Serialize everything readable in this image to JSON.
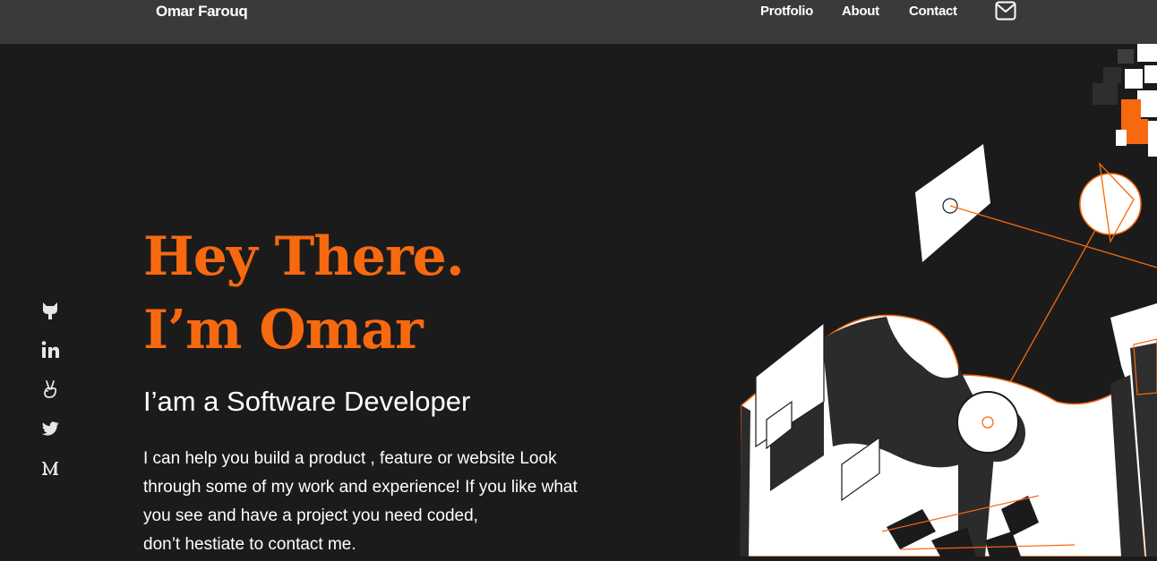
{
  "header": {
    "brand": "Omar Farouq",
    "nav": [
      "Protfolio",
      "About",
      "Contact"
    ]
  },
  "social_icons": [
    "github-icon",
    "linkedin-icon",
    "angellist-icon",
    "twitter-icon",
    "medium-icon"
  ],
  "hero": {
    "title_line1": "Hey There.",
    "title_line2": "I’m Omar",
    "subtitle": "I’am a Software Developer",
    "description_lines": [
      "I can help you build a product , feature or website Look",
      "through some of my work and experience! If you like what",
      "you see and have a project you need coded,",
      "don’t hestiate to contact me."
    ]
  },
  "colors": {
    "accent": "#f7690f",
    "background": "#1c1b1b",
    "header_bg": "#3a3a3a",
    "text": "#ffffff"
  }
}
